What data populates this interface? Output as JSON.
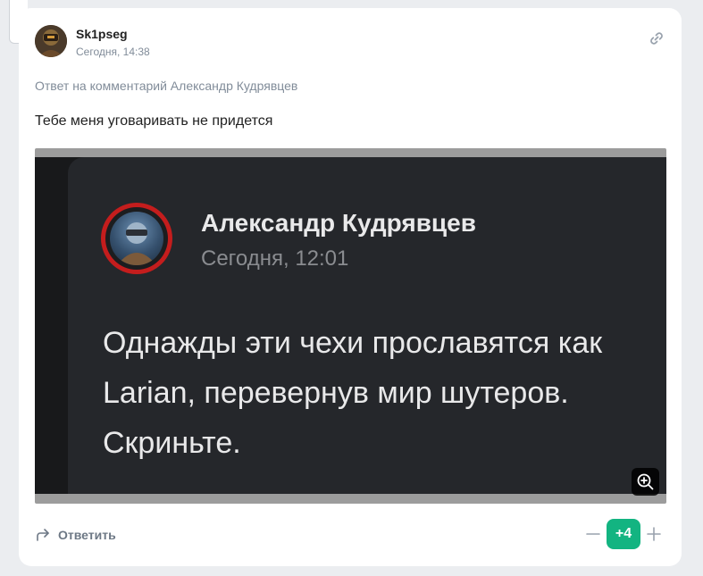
{
  "comment": {
    "author": "Sk1pseg",
    "time": "Сегодня, 14:38",
    "reply_to": "Ответ на комментарий Александр Кудрявцев",
    "text": "Тебе меня уговаривать не придется"
  },
  "screenshot": {
    "author": "Александр Кудрявцев",
    "time": "Сегодня, 12:01",
    "lines": [
      "Однажды эти чехи прославятся как",
      "Larian, перевернув мир шутеров.",
      "Скриньте."
    ]
  },
  "actions": {
    "reply_label": "Ответить",
    "score": "+4"
  },
  "icons": {
    "link": "link-icon",
    "zoom": "zoom-in-icon",
    "reply": "reply-arrow-icon",
    "minus": "minus-icon",
    "plus": "plus-icon"
  },
  "colors": {
    "accent_green": "#13b481",
    "muted": "#818c99",
    "image_background": "#25272b",
    "avatar_ring": "#c41d1d"
  }
}
